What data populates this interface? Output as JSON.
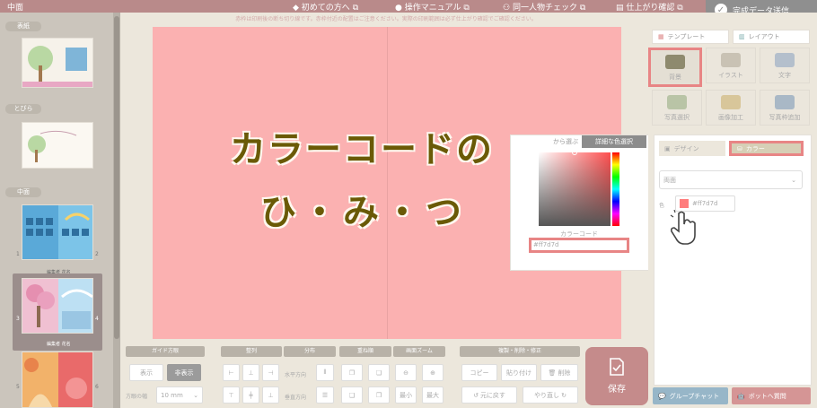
{
  "topbar": {
    "section": "中面",
    "links": [
      "初めての方へ",
      "操作マニュアル",
      "同一人物チェック",
      "仕上がり確認"
    ],
    "send_label": "完成データ送信"
  },
  "left": {
    "sections": [
      "表紙",
      "とびら",
      "中面"
    ],
    "pages": [
      {
        "left": "1",
        "right": "2",
        "caption": "編集者 花名"
      },
      {
        "left": "3",
        "right": "4",
        "caption": "編集者 花名"
      },
      {
        "left": "5",
        "right": "6",
        "caption": ""
      }
    ]
  },
  "canvas": {
    "notice": "赤枠は印刷後の断ち切り線です。赤枠付近の配置はご注意ください。実際の印刷範囲は必ず仕上がり確認でご確認ください。",
    "page_color": "#fbb1b1"
  },
  "overlay": {
    "line1": "カラーコードの",
    "line2": "ひ・み・つ",
    "color": "#6a5a06"
  },
  "popup": {
    "tab_palette": "から選ぶ",
    "tab_detail": "詳細な色選択",
    "code_label": "カラーコード",
    "code_value": "#ff7d7d"
  },
  "toolbar": {
    "guide": {
      "title": "ガイド方眼",
      "show": "表示",
      "hide": "非表示",
      "width_label": "方眼の幅",
      "width_value": "10 mm"
    },
    "align": {
      "title": "整列"
    },
    "distribute": {
      "title": "分布",
      "horizontal": "水平方向",
      "vertical": "垂直方向"
    },
    "layer": {
      "title": "重ね順"
    },
    "zoom": {
      "title": "画面ズーム",
      "min": "最小",
      "max": "最大"
    },
    "edit": {
      "title": "複製・削除・修正",
      "copy": "コピー",
      "paste": "貼り付け",
      "delete": "削除",
      "undo": "元に戻す",
      "redo": "やり直し"
    },
    "save": "保存"
  },
  "right": {
    "tabs": [
      "テンプレート",
      "レイアウト"
    ],
    "tools": [
      "背景",
      "イラスト",
      "文字",
      "写真選択",
      "画像加工",
      "写真枠追加"
    ],
    "subtabs": [
      "デザイン",
      "カラー"
    ],
    "target": "両面",
    "color_label": "色",
    "color_value": "#ff7d7d",
    "chat": "グループチャット",
    "bot": "ボットへ質問"
  },
  "colors": {
    "accent": "#e88585",
    "brand": "#b98a8a"
  }
}
